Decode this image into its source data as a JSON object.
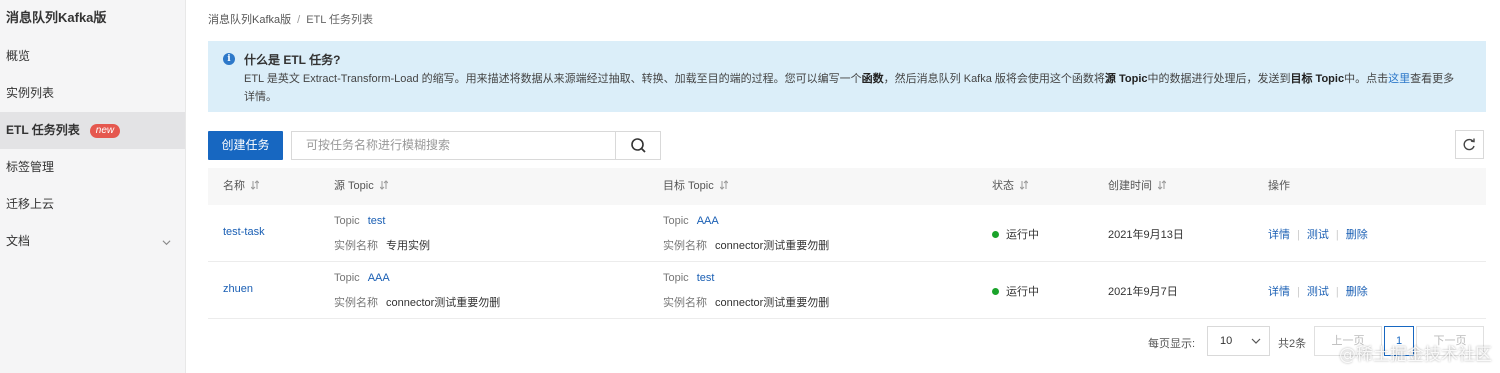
{
  "sidebar": {
    "title": "消息队列Kafka版",
    "items": [
      {
        "label": "概览"
      },
      {
        "label": "实例列表"
      },
      {
        "label": "ETL 任务列表",
        "badge": "new"
      },
      {
        "label": "标签管理"
      },
      {
        "label": "迁移上云"
      },
      {
        "label": "文档"
      }
    ]
  },
  "breadcrumb": {
    "root": "消息队列Kafka版",
    "separator": "/",
    "current": "ETL 任务列表"
  },
  "notice": {
    "title": "什么是 ETL 任务?",
    "text_1": "ETL 是英文 Extract-Transform-Load 的缩写。用来描述将数据从来源端经过抽取、转换、加载至目的端的过程。您可以编写一个",
    "bold_1": "函数",
    "text_2": "，然后消息队列 Kafka 版将会使用这个函数将",
    "bold_2": "源 Topic",
    "text_3": "中的数据进行处理后，发送到",
    "bold_3": "目标 Topic",
    "text_4": "中。点击",
    "link": "这里",
    "text_5": "查看更多详情。"
  },
  "toolbar": {
    "create_label": "创建任务",
    "search_placeholder": "可按任务名称进行模糊搜索"
  },
  "table": {
    "headers": {
      "name": "名称",
      "source": "源 Topic",
      "target": "目标 Topic",
      "status": "状态",
      "created": "创建时间",
      "actions": "操作"
    },
    "topic_label": "Topic",
    "instance_label": "实例名称",
    "rows": [
      {
        "name": "test-task",
        "source_topic": "test",
        "source_instance": "专用实例",
        "target_topic": "AAA",
        "target_instance": "connector测试重要勿删",
        "status": "运行中",
        "created": "2021年9月13日"
      },
      {
        "name": "zhuen",
        "source_topic": "AAA",
        "source_instance": "connector测试重要勿删",
        "target_topic": "test",
        "target_instance": "connector测试重要勿删",
        "status": "运行中",
        "created": "2021年9月7日"
      }
    ],
    "actions": {
      "detail": "详情",
      "test": "测试",
      "delete": "删除"
    }
  },
  "pagination": {
    "page_size_label": "每页显示:",
    "page_size": "10",
    "total": "共2条",
    "prev": "上一页",
    "current_page": "1",
    "next": "下一页"
  },
  "watermark": "@稀土掘金技术社区",
  "colors": {
    "primary": "#1767c1",
    "notice_bg": "#dbeef9",
    "running": "#1aa32a",
    "badge": "#e5584f"
  }
}
